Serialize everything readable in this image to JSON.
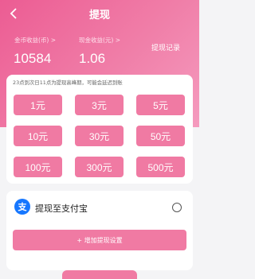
{
  "header": {
    "title": "提现",
    "coin_label": "金币收益(币) >",
    "coin_value": "10584",
    "cash_label": "现金收益(元) >",
    "cash_value": "1.06",
    "record_label": "提现记录"
  },
  "notice": "23点到次日11点为提现高峰期，可能会延迟到账",
  "amounts": [
    "1元",
    "3元",
    "5元",
    "10元",
    "30元",
    "50元",
    "100元",
    "300元",
    "500元"
  ],
  "method": {
    "icon_text": "支",
    "label": "提现至支付宝",
    "add_label": "+ 增加提现设置"
  },
  "colors": {
    "accent": "#f07aa3",
    "header_start": "#ec5c93",
    "header_end": "#f59bbe"
  }
}
